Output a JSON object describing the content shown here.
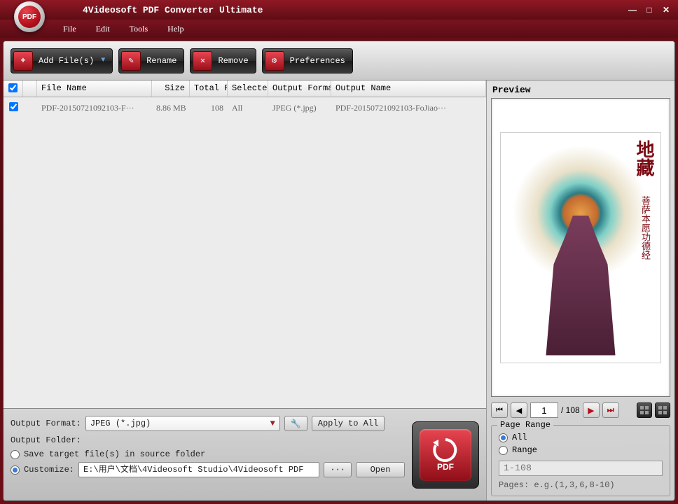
{
  "title": "4Videosoft PDF Converter Ultimate",
  "logo_text": "PDF",
  "menu": {
    "file": "File",
    "edit": "Edit",
    "tools": "Tools",
    "help": "Help"
  },
  "toolbar": {
    "add": "Add File(s)",
    "rename": "Rename",
    "remove": "Remove",
    "preferences": "Preferences"
  },
  "columns": {
    "name": "File Name",
    "size": "Size",
    "total": "Total Pa",
    "selected": "Selected",
    "format": "Output Format",
    "outname": "Output Name"
  },
  "rows": [
    {
      "name": "PDF-20150721092103-F···",
      "size": "8.86 MB",
      "total": "108",
      "selected": "All",
      "format": "JPEG (*.jpg)",
      "outname": "PDF-20150721092103-FoJiao···"
    }
  ],
  "output": {
    "format_label": "Output Format:",
    "format_value": "JPEG (*.jpg)",
    "apply_all": "Apply to All",
    "folder_label": "Output Folder:",
    "save_source": "Save target file(s) in source folder",
    "customize": "Customize:",
    "path": "E:\\用户\\文档\\4Videosoft Studio\\4Videosoft PDF",
    "open": "Open"
  },
  "convert_label": "PDF",
  "preview": {
    "title": "Preview",
    "cjk_big": "地藏",
    "cjk_small": "菩萨本愿功德经",
    "page": "1",
    "total": "/ 108",
    "range_legend": "Page Range",
    "all": "All",
    "range": "Range",
    "range_placeholder": "1-108",
    "hint": "Pages: e.g.(1,3,6,8-10)"
  }
}
